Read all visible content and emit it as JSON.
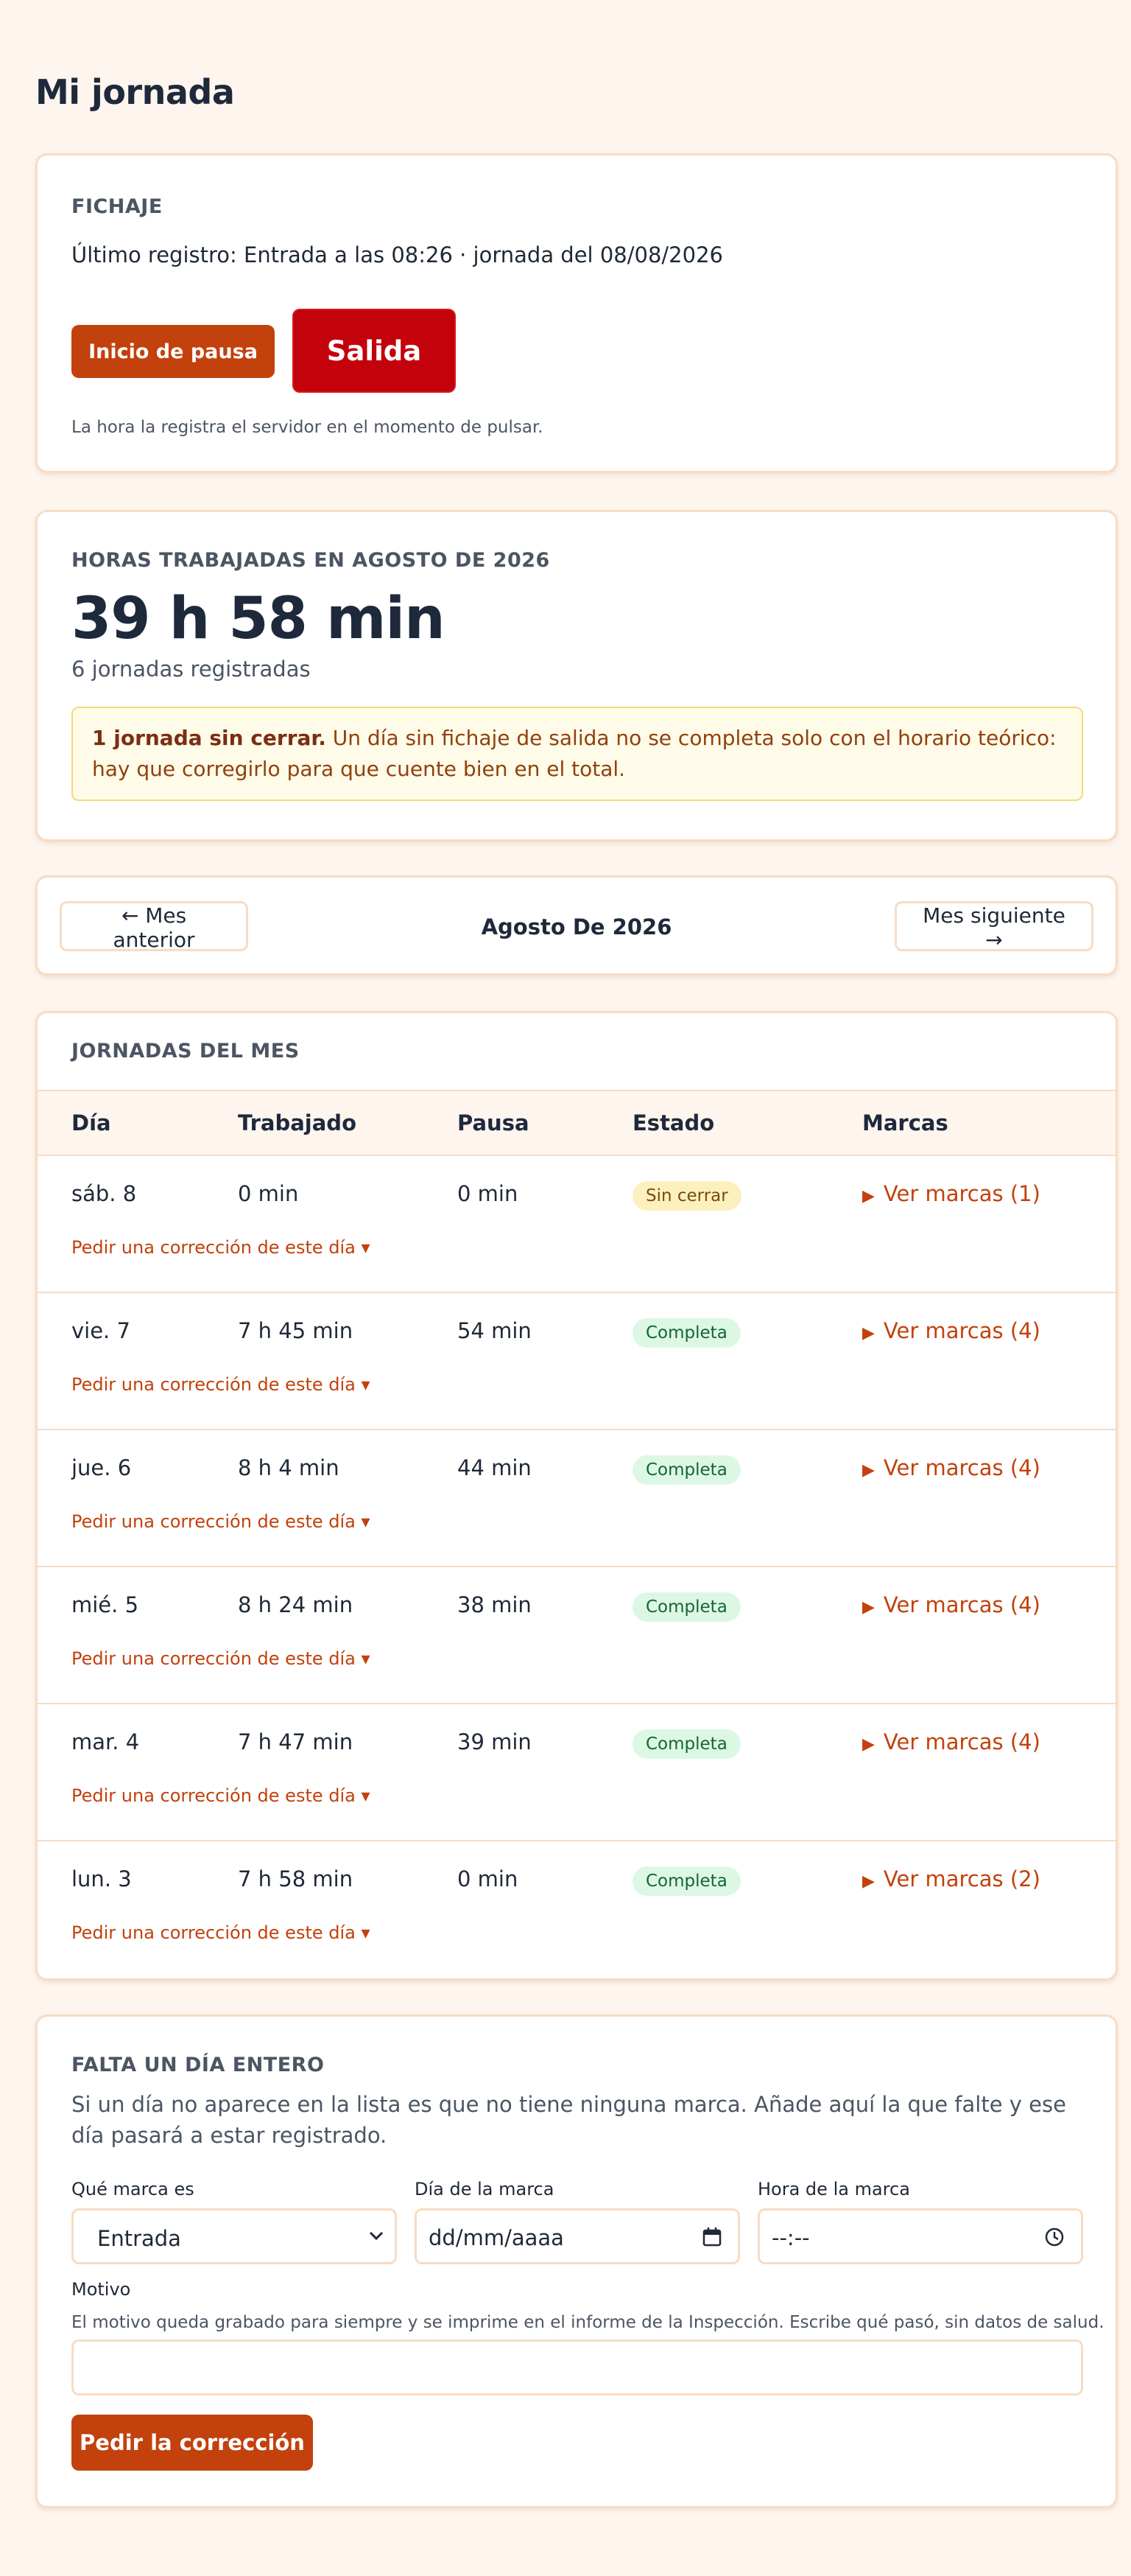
{
  "page": {
    "title": "Mi jornada"
  },
  "fichaje": {
    "section_title": "FICHAJE",
    "last_record": "Último registro: Entrada a las 08:26 · jornada del 08/08/2026",
    "pause_button": "Inicio de pausa",
    "exit_button": "Salida",
    "hint": "La hora la registra el servidor en el momento de pulsar."
  },
  "horas": {
    "section_title": "HORAS TRABAJADAS EN AGOSTO DE 2026",
    "total": "39 h 58 min",
    "count": "6 jornadas registradas",
    "warning_bold": "1 jornada sin cerrar.",
    "warning_text": " Un día sin fichaje de salida no se completa solo con el horario teórico: hay que corregirlo para que cuente bien en el total."
  },
  "nav": {
    "prev": "← Mes anterior",
    "month": "Agosto De 2026",
    "next": "Mes siguiente →"
  },
  "jornadas": {
    "section_title": "JORNADAS DEL MES",
    "columns": [
      "Día",
      "Trabajado",
      "Pausa",
      "Estado",
      "Marcas"
    ],
    "correction_link": "Pedir una corrección de este día ▾",
    "rows": [
      {
        "dia": "sáb. 8",
        "trabajado": "0 min",
        "pausa": "0 min",
        "estado": "Sin cerrar",
        "estado_type": "open",
        "marcas": "Ver marcas (1)"
      },
      {
        "dia": "vie. 7",
        "trabajado": "7 h 45 min",
        "pausa": "54 min",
        "estado": "Completa",
        "estado_type": "done",
        "marcas": "Ver marcas (4)"
      },
      {
        "dia": "jue. 6",
        "trabajado": "8 h 4 min",
        "pausa": "44 min",
        "estado": "Completa",
        "estado_type": "done",
        "marcas": "Ver marcas (4)"
      },
      {
        "dia": "mié. 5",
        "trabajado": "8 h 24 min",
        "pausa": "38 min",
        "estado": "Completa",
        "estado_type": "done",
        "marcas": "Ver marcas (4)"
      },
      {
        "dia": "mar. 4",
        "trabajado": "7 h 47 min",
        "pausa": "39 min",
        "estado": "Completa",
        "estado_type": "done",
        "marcas": "Ver marcas (4)"
      },
      {
        "dia": "lun. 3",
        "trabajado": "7 h 58 min",
        "pausa": "0 min",
        "estado": "Completa",
        "estado_type": "done",
        "marcas": "Ver marcas (2)"
      }
    ]
  },
  "falta": {
    "section_title": "FALTA UN DÍA ENTERO",
    "description": "Si un día no aparece en la lista es que no tiene ninguna marca. Añade aquí la que falte y ese día pasará a estar registrado.",
    "type_label": "Qué marca es",
    "type_value": "Entrada",
    "date_label": "Día de la marca",
    "date_placeholder": "dd/mm/aaaa",
    "time_label": "Hora de la marca",
    "time_placeholder": "--:--",
    "reason_label": "Motivo",
    "reason_hint": "El motivo queda grabado para siempre y se imprime en el informe de la Inspección. Escribe qué pasó, sin datos de salud.",
    "reason_value": "",
    "submit": "Pedir la corrección"
  }
}
